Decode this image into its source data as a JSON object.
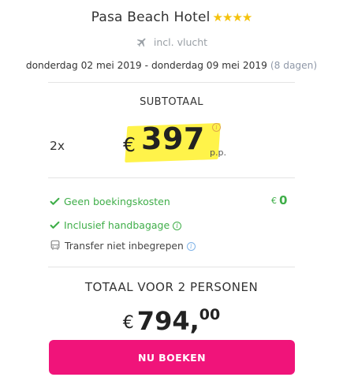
{
  "hotel": {
    "name": "Pasa Beach Hotel",
    "stars": "★★★★",
    "star_color": "#f4c20d"
  },
  "flight": {
    "icon": "plane-icon",
    "label": "incl. vlucht"
  },
  "dates": {
    "from": "donderdag 02 mei 2019",
    "separator": "-",
    "to": "donderdag 09 mei 2019",
    "duration": "(8 dagen)"
  },
  "subtotal": {
    "label": "SUBTOTAAL",
    "quantity": "2x",
    "currency": "€",
    "amount": "397",
    "unit": "p.p.",
    "highlight_color": "#fff34a"
  },
  "features": [
    {
      "icon": "check-icon",
      "label": "Geen boekingskosten",
      "status": "included"
    },
    {
      "icon": "check-icon",
      "label": "Inclusief handbagage",
      "status": "included",
      "info_icon": "info-icon"
    },
    {
      "icon": "bus-icon",
      "label": "Transfer niet inbegrepen",
      "status": "excluded",
      "info_icon": "info-icon"
    }
  ],
  "booking_cost": {
    "currency": "€",
    "value": "0"
  },
  "total": {
    "label": "TOTAAL VOOR 2 PERSONEN",
    "currency": "€",
    "integer": "794,",
    "decimals": "00"
  },
  "cta": {
    "label": "NU BOEKEN",
    "color": "#f0147a"
  },
  "colors": {
    "positive": "#3fae49",
    "muted": "#9aa0a6"
  }
}
